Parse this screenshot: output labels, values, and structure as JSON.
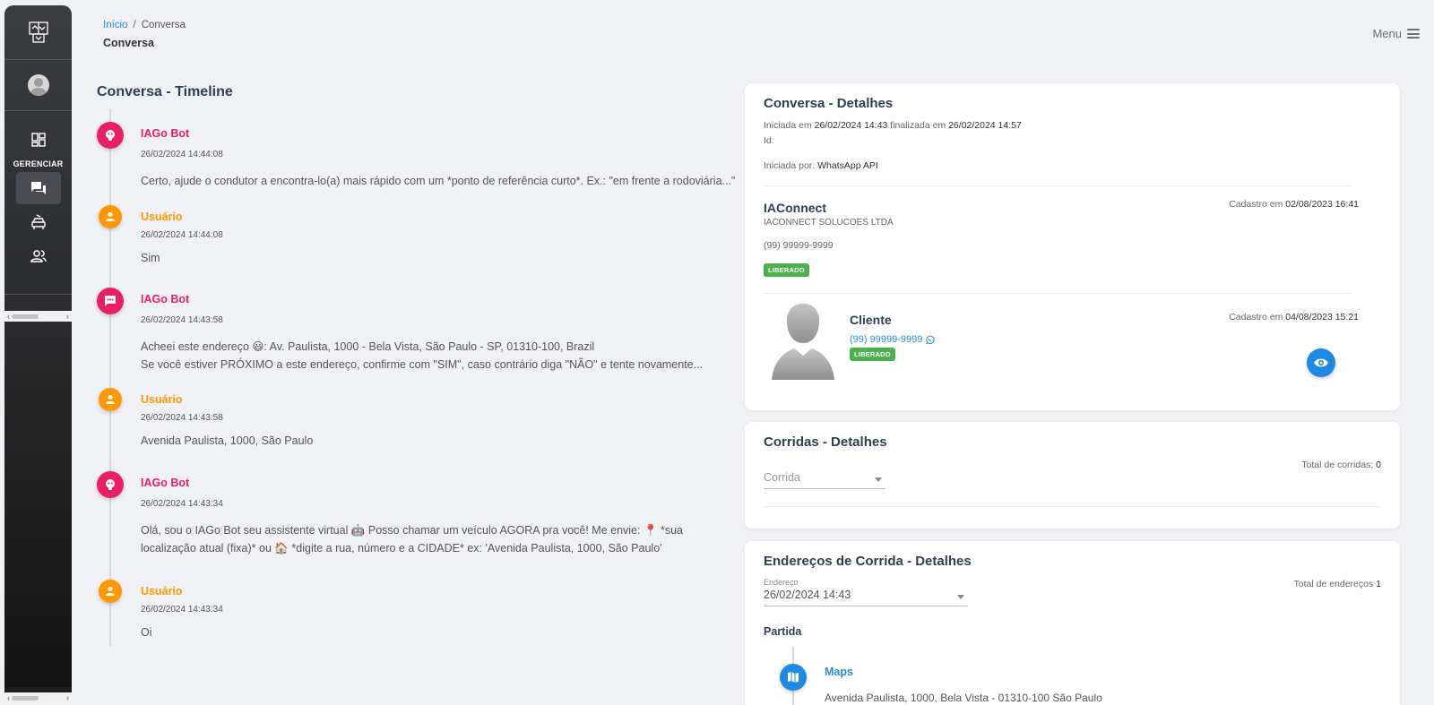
{
  "breadcrumb": {
    "home": "Início",
    "separator": "/",
    "current": "Conversa"
  },
  "page_title": "Conversa",
  "menu": {
    "label": "Menu"
  },
  "sidebar": {
    "heading": "GERENCIAR",
    "icons": [
      "logo-icon",
      "avatar",
      "dashboard-icon",
      "chat-icon",
      "car-icon",
      "users-icon"
    ]
  },
  "timeline": {
    "title": "Conversa - Timeline",
    "entries": [
      {
        "author": "IAGo Bot",
        "type": "bot",
        "icon": "robot-icon",
        "time": "26/02/2024 14:44:08",
        "lines": [
          "Certo, ajude o condutor a encontra-lo(a) mais rápido com um *ponto de referência curto*. Ex.: \"em frente a rodoviária...\""
        ]
      },
      {
        "author": "Usuário",
        "type": "user",
        "icon": "user-icon",
        "time": "26/02/2024 14:44:08",
        "lines": [
          "Sim"
        ]
      },
      {
        "author": "IAGo Bot",
        "type": "bot",
        "icon": "message-icon",
        "time": "26/02/2024 14:43:58",
        "lines": [
          "Acheei este endereço 😃: Av. Paulista, 1000 - Bela Vista, São Paulo - SP, 01310-100, Brazil",
          "Se você estiver PRÓXIMO a este endereço, confirme com \"SIM\", caso contrário diga \"NÃO\" e tente novamente..."
        ]
      },
      {
        "author": "Usuário",
        "type": "user",
        "icon": "user-icon",
        "time": "26/02/2024 14:43:58",
        "lines": [
          "Avenida Paulista, 1000, São Paulo"
        ]
      },
      {
        "author": "IAGo Bot",
        "type": "bot",
        "icon": "robot-icon",
        "time": "26/02/2024 14:43:34",
        "lines": [
          "Olá, sou o IAGo Bot seu assistente virtual 🤖 Posso chamar um veículo AGORA pra você! Me envie: 📍 *sua",
          "localização atual (fixa)* ou 🏠 *digite a rua, número e a CIDADE* ex: 'Avenida Paulista, 1000, São Paulo'"
        ]
      },
      {
        "author": "Usuário",
        "type": "user",
        "icon": "user-icon",
        "time": "26/02/2024 14:43:34",
        "lines": [
          "Oi"
        ]
      }
    ]
  },
  "conversa_detalhes": {
    "title": "Conversa - Detalhes",
    "started_prefix": "Iniciada em",
    "started_at": "26/02/2024 14:43",
    "finished_prefix": "finalizada em",
    "finished_at": "26/02/2024 14:57",
    "id_label": "Id:",
    "started_by_label": "Iniciada por:",
    "started_by": "WhatsApp API",
    "company": {
      "name": "IAConnect",
      "legal_name": "IACONNECT SOLUCOES LTDA",
      "phone": "(99) 99999-9999",
      "status": "LIBERADO",
      "registered_label": "Cadastro em",
      "registered_at": "02/08/2023 16:41"
    },
    "client": {
      "name": "Cliente",
      "phone": "(99) 99999-9999",
      "status": "LIBERADO",
      "registered_label": "Cadastro em",
      "registered_at": "04/08/2023 15:21"
    }
  },
  "corridas_detalhes": {
    "title": "Corridas - Detalhes",
    "select_placeholder": "Corrida",
    "total_label": "Total de corridas:",
    "total": "0"
  },
  "enderecos_detalhes": {
    "title": "Endereços de Corrida - Detalhes",
    "select_label": "Endereço",
    "select_value": "26/02/2024 14:43",
    "total_label": "Total de endereços",
    "total": "1",
    "section": "Partida",
    "item_title": "Maps",
    "item_address": "Avenida Paulista, 1000, Bela Vista - 01310-100 São Paulo"
  },
  "colors": {
    "bot": "#e91e63",
    "user": "#ff9800",
    "primary": "#1e88e5",
    "success": "#4caf50"
  }
}
